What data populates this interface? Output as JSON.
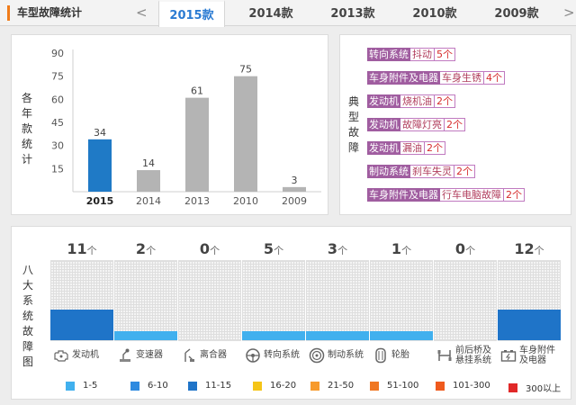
{
  "header": {
    "title": "车型故障统计",
    "prev_icon": "<",
    "next_icon": ">",
    "tabs": [
      {
        "label": "2015款",
        "active": true
      },
      {
        "label": "2014款",
        "active": false
      },
      {
        "label": "2013款",
        "active": false
      },
      {
        "label": "2010款",
        "active": false
      },
      {
        "label": "2009款",
        "active": false
      }
    ]
  },
  "year_panel": {
    "label_chars": [
      "各",
      "年",
      "款",
      "统",
      "计"
    ]
  },
  "chart_data": {
    "type": "bar",
    "categories": [
      "2015",
      "2014",
      "2013",
      "2010",
      "2009"
    ],
    "values": [
      34,
      14,
      61,
      75,
      3
    ],
    "data_labels": [
      "34",
      "14",
      "61",
      "75",
      "3"
    ],
    "highlight_index": 0,
    "highlight_color": "#1f7ac6",
    "bar_color": "#b4b4b4",
    "yticks": [
      "15",
      "30",
      "45",
      "60",
      "75",
      "90"
    ],
    "ylim": [
      0,
      90
    ],
    "grid": false
  },
  "typical_panel": {
    "label_chars": [
      "典",
      "型",
      "故",
      "障"
    ],
    "items": [
      {
        "system": "转向系统",
        "symptom": "抖动",
        "count": "5个"
      },
      {
        "system": "车身附件及电器",
        "symptom": "车身生锈",
        "count": "4个"
      },
      {
        "system": "发动机",
        "symptom": "烧机油",
        "count": "2个"
      },
      {
        "system": "发动机",
        "symptom": "故障灯亮",
        "count": "2个"
      },
      {
        "system": "发动机",
        "symptom": "漏油",
        "count": "2个"
      },
      {
        "system": "制动系统",
        "symptom": "刹车失灵",
        "count": "2个"
      },
      {
        "system": "车身附件及电器",
        "symptom": "行车电脑故障",
        "count": "2个"
      }
    ]
  },
  "systems_panel": {
    "label_chars": [
      "八",
      "大",
      "系",
      "统",
      "故",
      "障",
      "图"
    ],
    "unit": "个",
    "systems": [
      {
        "name_lines": [
          "发动机"
        ],
        "count": "11",
        "level": 2,
        "icon": "engine-icon"
      },
      {
        "name_lines": [
          "变速器"
        ],
        "count": "2",
        "level": 0,
        "icon": "gearbox-icon"
      },
      {
        "name_lines": [
          "离合器"
        ],
        "count": "0",
        "level": -1,
        "icon": "clutch-icon"
      },
      {
        "name_lines": [
          "转向系统"
        ],
        "count": "5",
        "level": 0,
        "icon": "steering-wheel-icon"
      },
      {
        "name_lines": [
          "制动系统"
        ],
        "count": "3",
        "level": 0,
        "icon": "brake-disc-icon"
      },
      {
        "name_lines": [
          "轮胎"
        ],
        "count": "1",
        "level": 0,
        "icon": "tire-icon"
      },
      {
        "name_lines": [
          "前后桥及",
          "悬挂系统"
        ],
        "count": "0",
        "level": -1,
        "icon": "suspension-icon"
      },
      {
        "name_lines": [
          "车身附件",
          "及电器"
        ],
        "count": "12",
        "level": 2,
        "icon": "battery-icon"
      }
    ],
    "legend": [
      {
        "label": "1-5",
        "color": "#41b0ee"
      },
      {
        "label": "6-10",
        "color": "#2e8ae0"
      },
      {
        "label": "11-15",
        "color": "#1f74c8"
      },
      {
        "label": "16-20",
        "color": "#f5c518"
      },
      {
        "label": "21-50",
        "color": "#f79a2c"
      },
      {
        "label": "51-100",
        "color": "#f07722"
      },
      {
        "label": "101-300",
        "color": "#ef5a1d"
      },
      {
        "label": "300以上",
        "color": "#e12828"
      }
    ]
  }
}
